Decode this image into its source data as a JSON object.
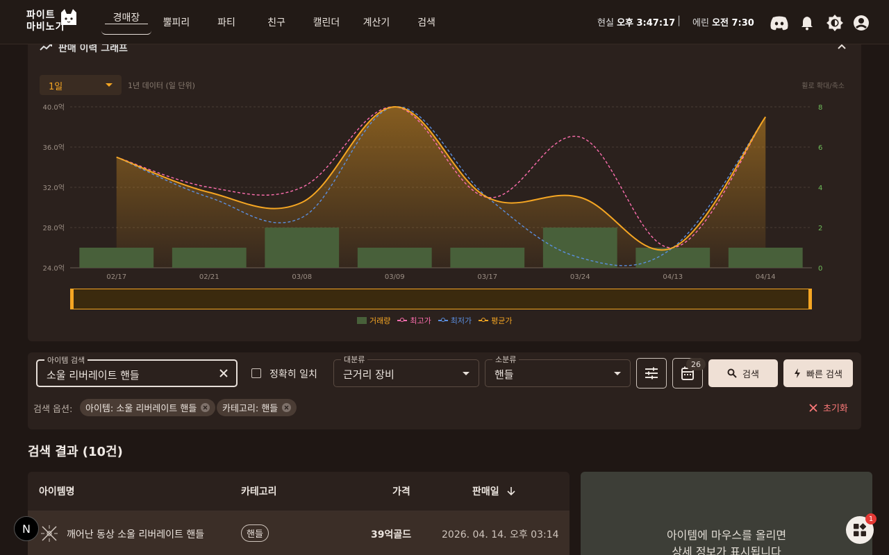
{
  "header": {
    "logo_text": "파이트\n마비노기",
    "nav": [
      {
        "label": "경매장",
        "active": true
      },
      {
        "label": "뿔피리",
        "active": false
      },
      {
        "label": "파티",
        "active": false
      },
      {
        "label": "친구",
        "active": false
      },
      {
        "label": "캘린더",
        "active": false
      },
      {
        "label": "계산기",
        "active": false
      },
      {
        "label": "검색",
        "active": false
      }
    ],
    "real_time_label": "현실",
    "real_time": "오후 3:47:17",
    "separator": "|",
    "erinn_time_label": "에린",
    "erinn_time": "오전 7:30",
    "icons": [
      "discord-icon",
      "bell-icon",
      "theme-icon",
      "account-icon"
    ]
  },
  "chart_panel": {
    "title": "판매 이력 그래프",
    "range_value": "1일",
    "range_hint": "1년 데이터 (일 단위)",
    "zoom_hint": "휠로 확대/축소"
  },
  "chart_data": {
    "type": "line",
    "categories": [
      "02/17",
      "02/21",
      "03/08",
      "03/09",
      "03/17",
      "03/24",
      "04/13",
      "04/14"
    ],
    "y_left_ticks": [
      "24.0억",
      "28.0억",
      "32.0억",
      "36.0억",
      "40.0억"
    ],
    "y_left_range": [
      24,
      40
    ],
    "y_right_ticks": [
      "0",
      "2",
      "4",
      "6",
      "8"
    ],
    "y_right_range": [
      0,
      8
    ],
    "series": [
      {
        "name": "거래량",
        "type": "bar",
        "axis": "right",
        "values": [
          1,
          1,
          2,
          1,
          1,
          2,
          1,
          1
        ],
        "color": "#48603a"
      },
      {
        "name": "최고가",
        "type": "line",
        "axis": "left",
        "values": [
          35,
          32,
          32,
          40,
          31,
          37,
          26,
          39
        ],
        "color": "#ff6fb0"
      },
      {
        "name": "최저가",
        "type": "line",
        "axis": "left",
        "values": [
          35,
          31,
          29,
          40,
          31,
          25,
          26,
          39
        ],
        "color": "#5b8fe0"
      },
      {
        "name": "평균가",
        "type": "line",
        "axis": "left",
        "values": [
          35,
          31.5,
          30.5,
          40,
          31,
          31,
          26,
          39
        ],
        "color": "#f5a623"
      }
    ],
    "grid": true,
    "legend": "bottom-center"
  },
  "search": {
    "item_label": "아이템 검색",
    "item_value": "소울 리버레이트 핸들",
    "exact_match_label": "정확히 일치",
    "exact_match_checked": false,
    "major_label": "대분류",
    "major_value": "근거리 장비",
    "minor_label": "소분류",
    "minor_value": "핸들",
    "calendar_badge": "26",
    "search_btn": "검색",
    "quick_search_btn": "빠른 검색",
    "options_label": "검색 옵션:",
    "chips": [
      "아이템: 소울 리버레이트 핸들",
      "카테고리: 핸들"
    ],
    "reset_label": "초기화"
  },
  "results": {
    "title": "검색 결과 (10건)",
    "columns": [
      "아이템명",
      "카테고리",
      "가격",
      "판매일"
    ],
    "rows": [
      {
        "name": "깨어난 동상 소울 리버레이트 핸들",
        "category": "핸들",
        "price": "39억골드",
        "date": "2026. 04. 14. 오후 03:14"
      }
    ]
  },
  "detail_panel": {
    "line1": "아이템에 마우스를 올리면",
    "line2": "상세 정보가 표시됩니다"
  },
  "fab": {
    "n_label": "N",
    "notification_count": "1"
  }
}
